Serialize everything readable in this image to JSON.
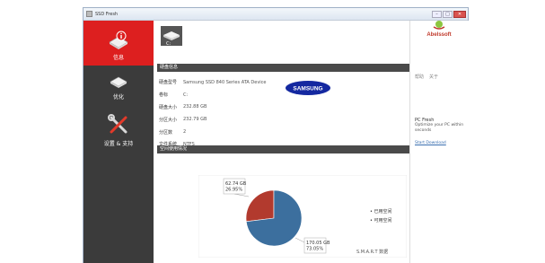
{
  "window": {
    "title": "SSD Fresh",
    "minimize": "–",
    "maximize": "□",
    "close": "✕"
  },
  "sidebar": {
    "items": [
      {
        "label": "信息",
        "icon": "drive-info-icon",
        "active": true
      },
      {
        "label": "优化",
        "icon": "drive-optimize-icon",
        "active": false
      },
      {
        "label": "设置 & 支持",
        "icon": "tools-icon",
        "active": false
      }
    ]
  },
  "main": {
    "drive_letter": "C:",
    "section_drive_info": "硬盘信息",
    "section_space": "空间使用情况",
    "fields": [
      {
        "key": "硬盘型号",
        "value": "Samsung SSD 840 Series ATA Device"
      },
      {
        "key": "卷标",
        "value": "C:"
      },
      {
        "key": "硬盘大小",
        "value": "232.88 GB"
      },
      {
        "key": "分区大小",
        "value": "232.79 GB"
      },
      {
        "key": "分区数",
        "value": "2"
      },
      {
        "key": "文件系统",
        "value": "NTFS"
      }
    ],
    "brand_logo": "SAMSUNG",
    "smart_link": "S.M.A.R.T 数据"
  },
  "right_panel": {
    "brand": "Abelssoft",
    "links": [
      "帮助",
      "关于"
    ],
    "title": "PC Fresh",
    "desc": "Optimize your PC within seconds",
    "download": "Start Download"
  },
  "chart_data": {
    "type": "pie",
    "categories": [
      "已用空间",
      "可用空间"
    ],
    "values": [
      62.74,
      170.05
    ],
    "units": "GB",
    "labels": [
      {
        "size": "62.74 GB",
        "percent": "26.95%"
      },
      {
        "size": "170.05 GB",
        "percent": "73.05%"
      }
    ],
    "colors": [
      "#b23a2e",
      "#3c6f9e"
    ],
    "legend_position": "right"
  }
}
